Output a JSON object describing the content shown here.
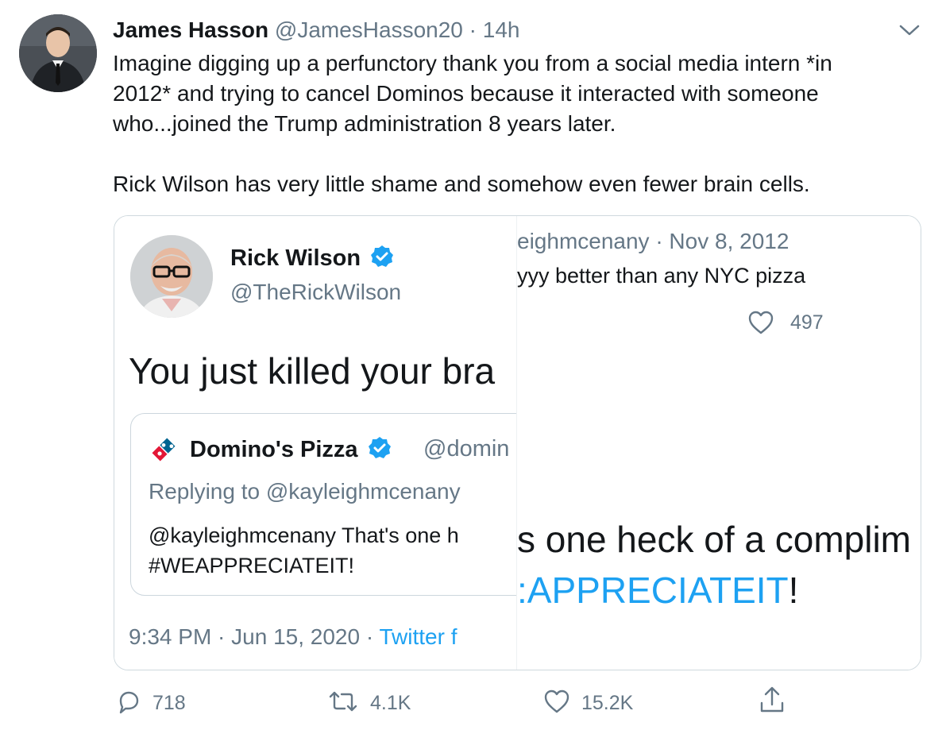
{
  "tweet": {
    "author_name": "James Hasson",
    "author_handle": "@JamesHasson20",
    "separator": "·",
    "time": "14h",
    "body_line_1": "Imagine digging up a perfunctory thank you from a social media intern *in",
    "body_line_2": "2012* and trying to cancel Dominos because it interacted with someone",
    "body_line_3": "who...joined the Trump administration 8 years later.",
    "body_line_4": "Rick Wilson has very little shame and somehow even fewer brain cells."
  },
  "embedded_left": {
    "author_name": "Rick Wilson",
    "author_handle": "@TheRickWilson",
    "text": "You just killed your bra",
    "quote": {
      "author_name": "Domino's Pizza",
      "author_handle": "@domin",
      "replying_to": "Replying to @kayleighmcenany",
      "text_line_1": "@kayleighmcenany That's one h",
      "text_line_2": "#WEAPPRECIATEIT!"
    },
    "meta_time": "9:34 PM · Jun 15, 2020 · ",
    "meta_source": "Twitter f"
  },
  "embedded_right": {
    "meta": "eighmcenany · Nov 8, 2012",
    "text": "yyy better than any NYC pizza",
    "likes": "497",
    "compliment": "s one heck of a complim",
    "hashtag": "APPRECIATEIT",
    "hashtag_prefix": ":",
    "bang": "!"
  },
  "actions": {
    "replies": "718",
    "retweets": "4.1K",
    "likes": "15.2K"
  },
  "icons": {
    "caret": "chevron-down-icon",
    "reply": "reply-icon",
    "retweet": "retweet-icon",
    "like": "heart-icon",
    "share": "share-icon",
    "verified": "verified-badge-icon"
  },
  "colors": {
    "accent": "#1da1f2",
    "secondary_text": "#657786",
    "primary_text": "#14171a",
    "border": "#cfd9de"
  }
}
